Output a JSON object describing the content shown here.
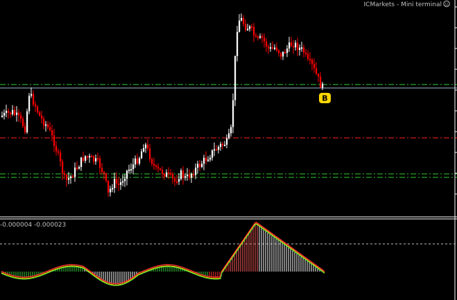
{
  "window": {
    "title": "ICMarkets - Mini terminal"
  },
  "icons": {
    "title_icon": "smiley-icon",
    "trade_marker": "buy-marker-icon"
  },
  "trade_marker": {
    "label": "B",
    "color": "#ffd700"
  },
  "oscillator": {
    "values_label": "-0.000004 -0.000023"
  },
  "colors": {
    "bull": "#ffffff",
    "bear": "#ff0000",
    "ask_line": "#a0b8d0",
    "green_level": "#32cd32",
    "red_level": "#ff2020",
    "hist_pos": "#ff3030",
    "hist_neg": "#3ad13a",
    "signal_line": "#ffd700",
    "separator": "#ffffff"
  }
}
